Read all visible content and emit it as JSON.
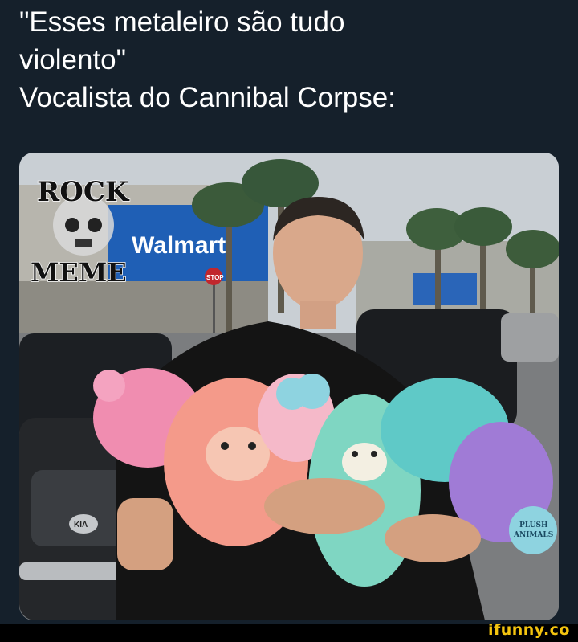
{
  "caption": {
    "line1": "\"Esses metaleiro são tudo",
    "line2": "violento\"",
    "line3": "Vocalista do Cannibal Corpse:"
  },
  "photo": {
    "watermark_line1": "ROCK",
    "watermark_line2": "MEME",
    "store_sign": "Walmart",
    "stop_sign": "STOP",
    "car_brand": "KIA",
    "badge_text_1": "PLUSH",
    "badge_text_2": "ANIMALS"
  },
  "footer": {
    "brand": "ifunny.co"
  },
  "colors": {
    "background": "#15202b",
    "caption_text": "#ffffff",
    "ifunny_brand": "#f4c40f"
  }
}
